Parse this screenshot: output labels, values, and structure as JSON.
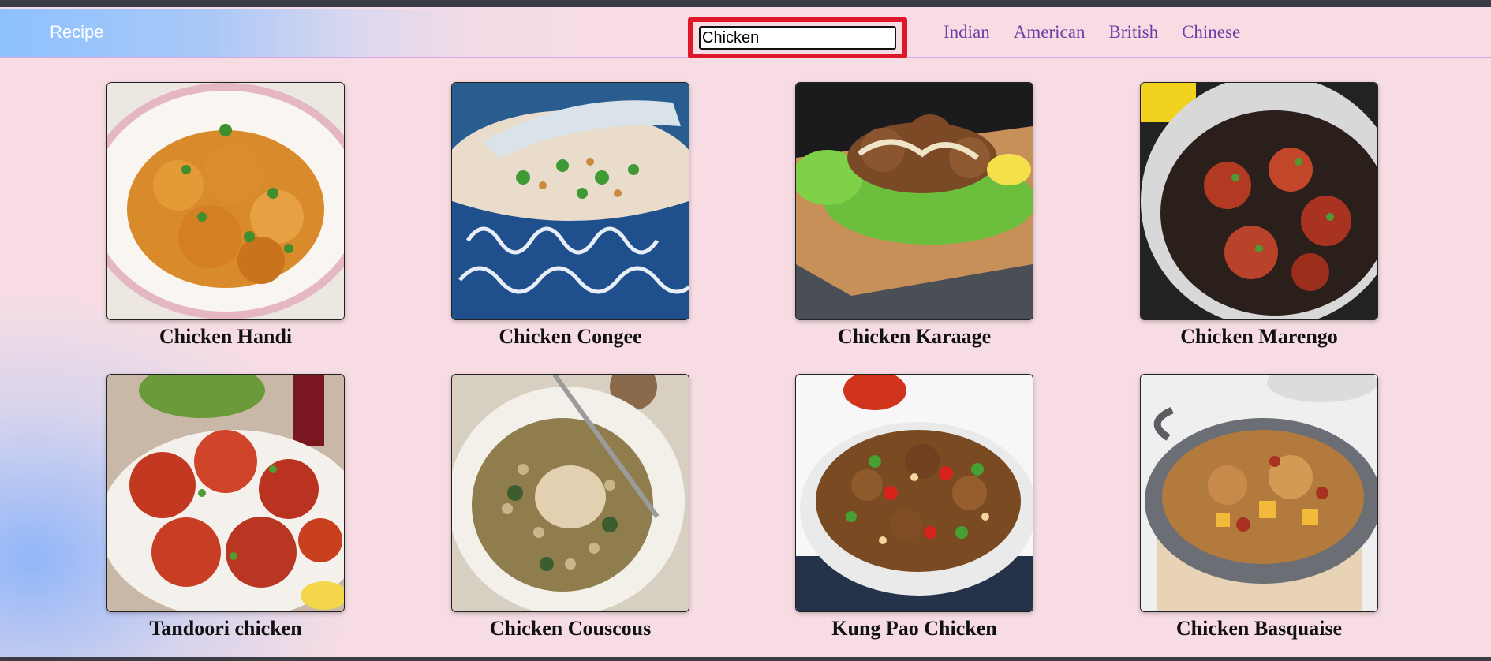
{
  "brand": "Recipe",
  "search": {
    "value": "Chicken"
  },
  "nav": [
    "Indian",
    "American",
    "British",
    "Chinese"
  ],
  "recipes": [
    {
      "title": "Chicken Handi",
      "image": "chicken-handi-photo"
    },
    {
      "title": "Chicken Congee",
      "image": "chicken-congee-photo"
    },
    {
      "title": "Chicken Karaage",
      "image": "chicken-karaage-photo"
    },
    {
      "title": "Chicken Marengo",
      "image": "chicken-marengo-photo"
    },
    {
      "title": "Tandoori chicken",
      "image": "tandoori-chicken-photo"
    },
    {
      "title": "Chicken Couscous",
      "image": "chicken-couscous-photo"
    },
    {
      "title": "Kung Pao Chicken",
      "image": "kung-pao-chicken-photo"
    },
    {
      "title": "Chicken Basquaise",
      "image": "chicken-basquaise-photo"
    }
  ],
  "colors": {
    "accent": "#6b3fa6",
    "highlight": "#e0162a",
    "background": "#f7dde3"
  }
}
